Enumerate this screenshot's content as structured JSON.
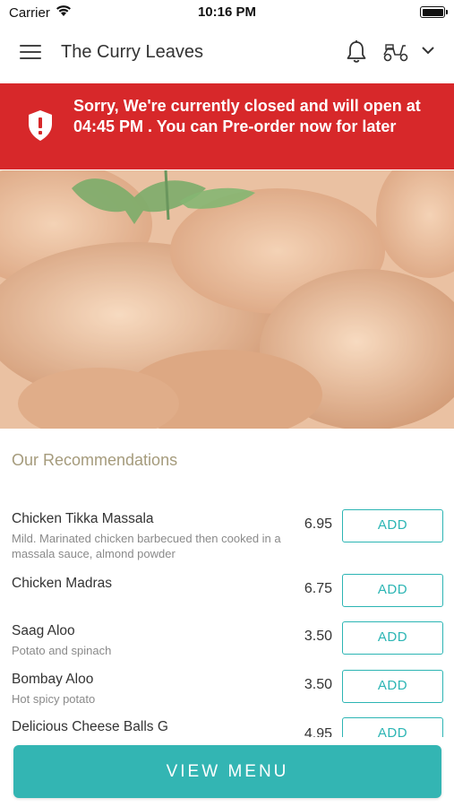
{
  "status_bar": {
    "carrier": "Carrier",
    "time": "10:16 PM"
  },
  "header": {
    "title": "The Curry Leaves",
    "icons": [
      "menu-icon",
      "bell-icon",
      "scooter-icon",
      "chevron-down-icon"
    ]
  },
  "banner": {
    "message": "Sorry, We're currently closed and will open at 04:45 PM . You can Pre-order now for later",
    "color": "#d7282a",
    "icon": "shield-alert-icon"
  },
  "recommendations": {
    "title": "Our Recommendations",
    "items": [
      {
        "name": "Chicken Tikka Massala",
        "description": "Mild. Marinated chicken barbecued then cooked in a massala sauce, almond powder",
        "price": "6.95",
        "button": "ADD"
      },
      {
        "name": "Chicken Madras",
        "description": "",
        "price": "6.75",
        "button": "ADD"
      },
      {
        "name": "Saag Aloo",
        "description": "Potato and spinach",
        "price": "3.50",
        "button": "ADD"
      },
      {
        "name": "Bombay Aloo",
        "description": "Hot spicy potato",
        "price": "3.50",
        "button": "ADD"
      },
      {
        "name": "Delicious Cheese Balls G",
        "description": "",
        "price": "4.95",
        "button": "ADD"
      }
    ]
  },
  "footer": {
    "view_menu_label": "VIEW MENU"
  },
  "colors": {
    "accent": "#33b5b3",
    "section_title": "#a59b7c",
    "banner": "#d7282a"
  }
}
